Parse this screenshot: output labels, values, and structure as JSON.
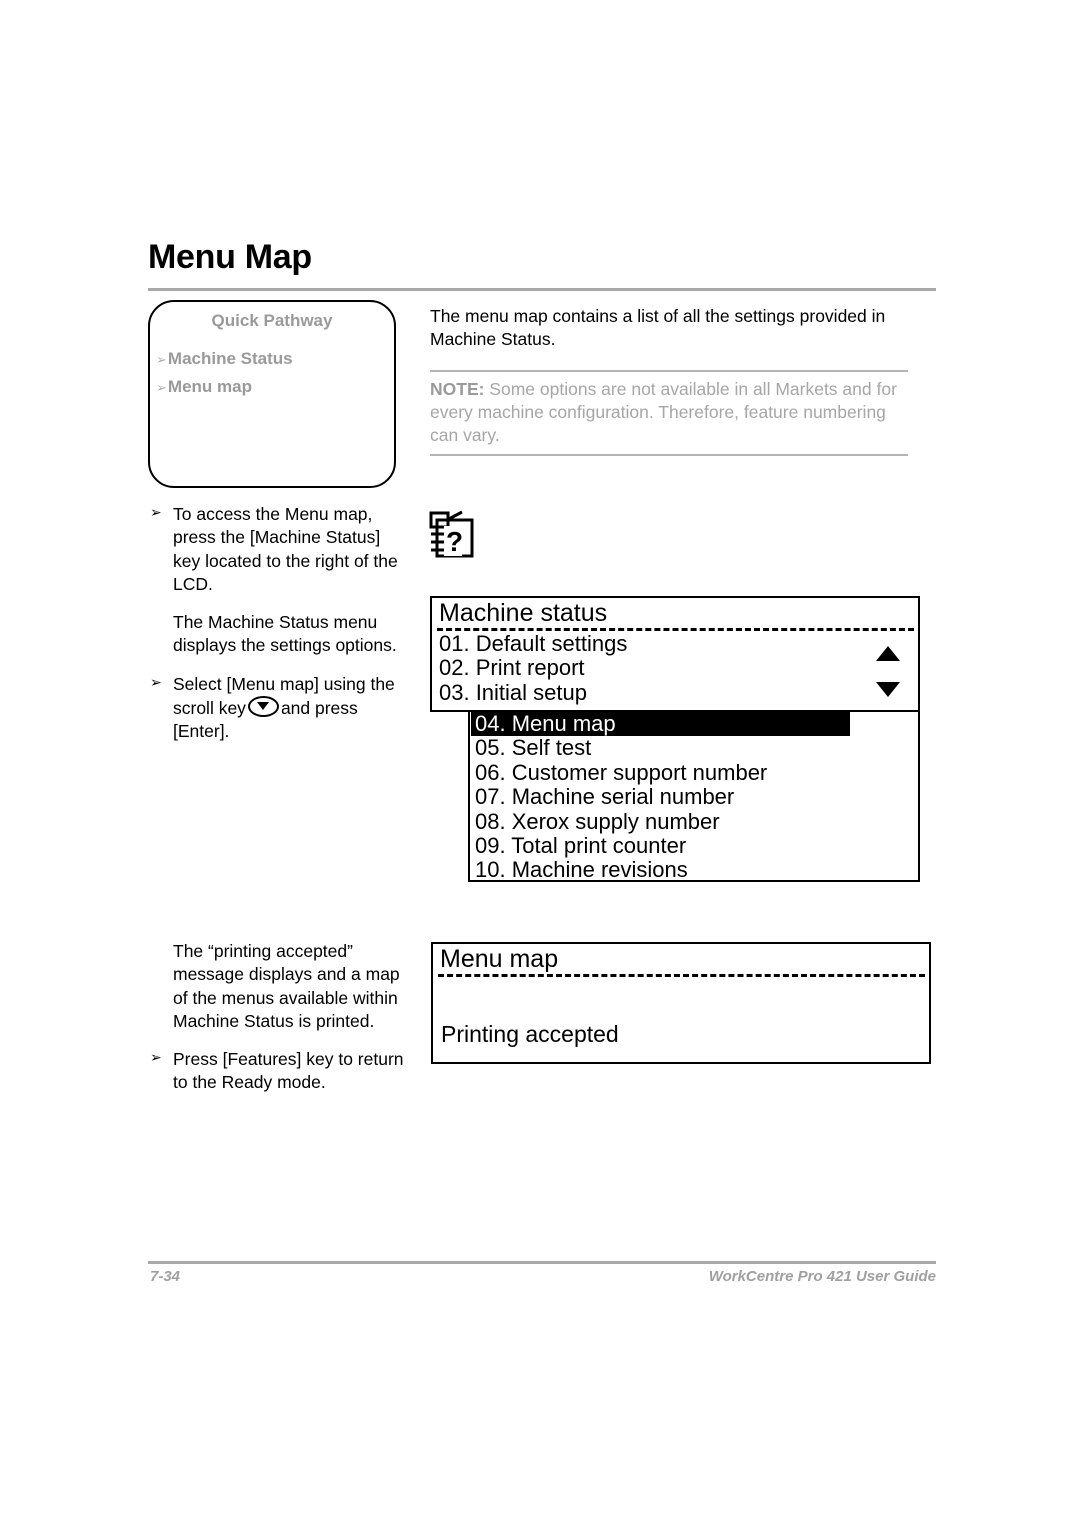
{
  "page": {
    "title": "Menu Map"
  },
  "quick_pathway": {
    "heading": "Quick Pathway",
    "arrow_glyph": "➢",
    "items": [
      {
        "label": "Machine Status"
      },
      {
        "label": "Menu map"
      }
    ]
  },
  "left_column": {
    "bullet_glyph": "➢",
    "step1": "To access the Menu map, press the [Machine Status] key located to the right of the LCD.",
    "note1": "The Machine Status menu displays the settings options.",
    "step2_before": "Select [Menu map] using the scroll key",
    "step2_after": "and press [Enter].",
    "scroll_key_icon": "scroll-down-key-icon",
    "result_text": "The “printing accepted” message displays and a map of the menus available within Machine Status is printed.",
    "step3": "Press [Features] key to return to the Ready mode."
  },
  "right_column": {
    "intro": "The menu map contains a list of all the settings provided in Machine Status.",
    "note_label": "NOTE:",
    "note_body": " Some options are not available in all Markets and for every machine configuration. Therefore, feature numbering can vary.",
    "help_icon": "menu-map-help-icon"
  },
  "lcd_machine_status": {
    "header": "Machine status",
    "visible_rows": [
      {
        "label": "01. Default settings"
      },
      {
        "label": "02. Print report"
      },
      {
        "label": "03. Initial setup"
      }
    ],
    "scroll_up_icon": "scroll-up-arrow-icon",
    "scroll_down_icon": "scroll-down-arrow-icon",
    "sub_rows": [
      {
        "label": "04. Menu map",
        "selected": true
      },
      {
        "label": "05. Self test",
        "selected": false
      },
      {
        "label": "06. Customer support number",
        "selected": false
      },
      {
        "label": "07. Machine serial number",
        "selected": false
      },
      {
        "label": "08. Xerox supply number",
        "selected": false
      },
      {
        "label": "09. Total print counter",
        "selected": false
      },
      {
        "label": "10. Machine revisions",
        "selected": false
      }
    ]
  },
  "lcd_menu_map": {
    "header": "Menu map",
    "message": "Printing accepted"
  },
  "footer": {
    "page_number": "7-34",
    "guide_name": "WorkCentre Pro 421 User Guide"
  },
  "colors": {
    "gray_rule": "#a8a8a8",
    "muted_text": "#9a9a9a",
    "note_text": "#a6a6a6",
    "highlight_bg": "#000000",
    "highlight_fg": "#ffffff"
  }
}
